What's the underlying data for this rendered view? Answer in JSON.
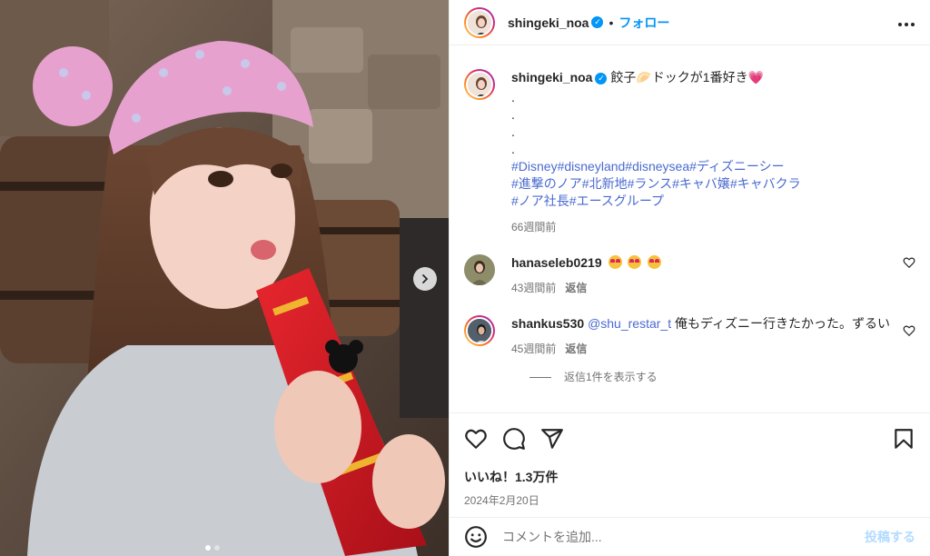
{
  "post": {
    "image_alt": "",
    "carousel_dots": 2,
    "carousel_active": 0
  },
  "header": {
    "username": "shingeki_noa",
    "verified_glyph": "✓",
    "separator": "•",
    "follow_label": "フォロー",
    "more_icon": "more-dots-icon"
  },
  "caption": {
    "username": "shingeki_noa",
    "text": "餃子🥟ドックが1番好き💗",
    "dots": [
      ".",
      ".",
      ".",
      "."
    ],
    "hashtag_lines": [
      "#Disney#disneyland#disneysea#ディズニーシー",
      "#進撃のノア#北新地#ランス#キャバ嬢#キャバクラ",
      "#ノア社長#エースグループ"
    ],
    "time": "66週間前"
  },
  "comments": [
    {
      "username": "hanaseleb0219",
      "text": "",
      "emoji_count": 3,
      "time": "43週間前",
      "reply_label": "返信"
    },
    {
      "username": "shankus530",
      "mention": "@shu_restar_t",
      "text": " 俺もディズニー行きたかった。ずるい",
      "time": "45週間前",
      "reply_label": "返信",
      "view_replies": "返信1件を表示する"
    }
  ],
  "actions": {
    "likes": "いいね！1.3万件",
    "date": "2024年2月20日"
  },
  "composer": {
    "placeholder": "コメントを追加...",
    "post_label": "投稿する"
  },
  "colors": {
    "link": "#0095f6",
    "hashtag": "#4a6ad0",
    "secondary": "#737373"
  }
}
